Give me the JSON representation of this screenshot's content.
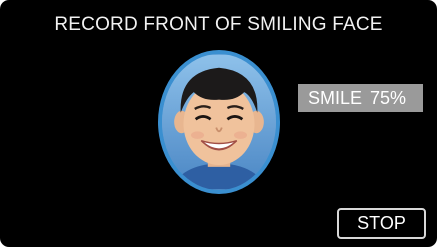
{
  "header": {
    "title": "RECORD FRONT OF SMILING FACE"
  },
  "smile_indicator": {
    "label": "SMILE",
    "value": "75%"
  },
  "controls": {
    "stop_label": "STOP"
  },
  "colors": {
    "screen_background": "#000000",
    "face_frame_border": "#3a8fd0",
    "badge_background": "#9a9a9a",
    "text": "#ffffff"
  }
}
